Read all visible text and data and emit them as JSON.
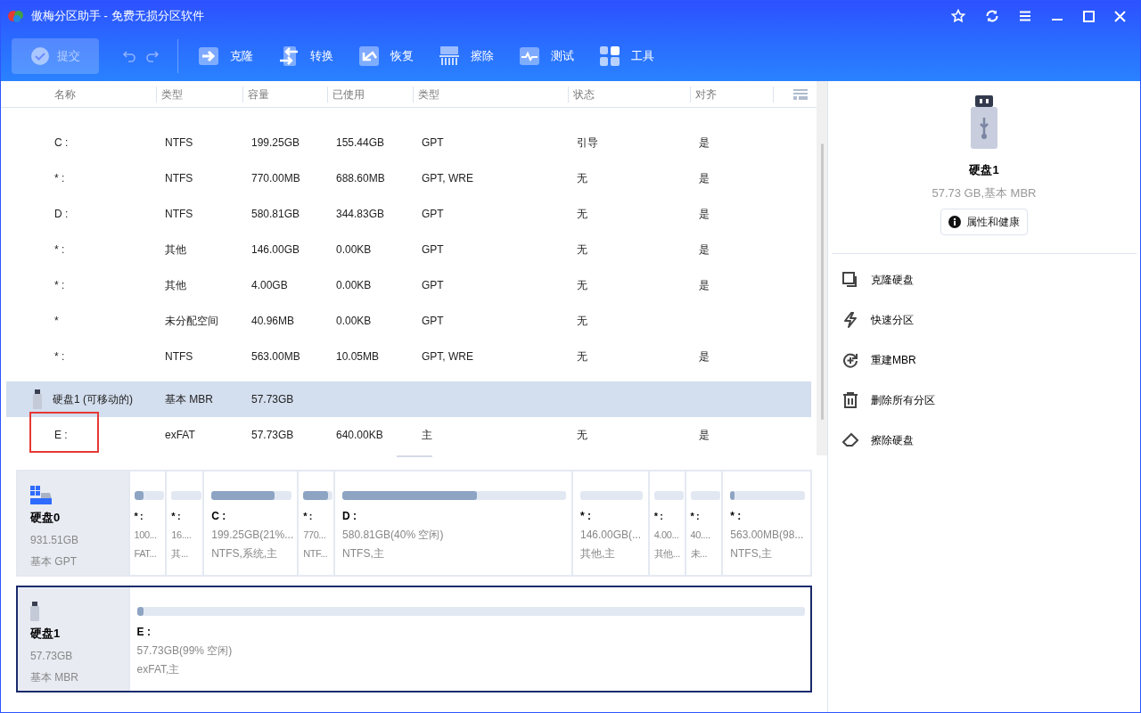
{
  "window": {
    "title": "傲梅分区助手 - 免费无损分区软件"
  },
  "toolbar": {
    "commit": {
      "label": "提交",
      "disabled": true
    },
    "tools": [
      {
        "kind": "clone",
        "label": "克隆"
      },
      {
        "kind": "convert",
        "label": "转换"
      },
      {
        "kind": "recover",
        "label": "恢复"
      },
      {
        "kind": "wipe",
        "label": "擦除"
      },
      {
        "kind": "test",
        "label": "测试"
      },
      {
        "kind": "tools",
        "label": "工具"
      }
    ]
  },
  "table": {
    "columns": [
      "名称",
      "类型",
      "容量",
      "已使用",
      "类型",
      "状态",
      "对齐"
    ],
    "rows": [
      {
        "kind": "partition",
        "selected": false,
        "highlighted": false,
        "cells": [
          "C :",
          "NTFS",
          "199.25GB",
          "155.44GB",
          "GPT",
          "引导",
          "是"
        ]
      },
      {
        "kind": "partition",
        "selected": false,
        "highlighted": false,
        "cells": [
          "* :",
          "NTFS",
          "770.00MB",
          "688.60MB",
          "GPT, WRE",
          "无",
          "是"
        ]
      },
      {
        "kind": "partition",
        "selected": false,
        "highlighted": false,
        "cells": [
          "D :",
          "NTFS",
          "580.81GB",
          "344.83GB",
          "GPT",
          "无",
          "是"
        ]
      },
      {
        "kind": "partition",
        "selected": false,
        "highlighted": false,
        "cells": [
          "* :",
          "其他",
          "146.00GB",
          "0.00KB",
          "GPT",
          "无",
          "是"
        ]
      },
      {
        "kind": "partition",
        "selected": false,
        "highlighted": false,
        "cells": [
          "* :",
          "其他",
          "4.00GB",
          "0.00KB",
          "GPT",
          "无",
          "是"
        ]
      },
      {
        "kind": "partition",
        "selected": false,
        "highlighted": false,
        "cells": [
          "*",
          "未分配空间",
          "40.96MB",
          "0.00KB",
          "GPT",
          "无",
          ""
        ]
      },
      {
        "kind": "partition",
        "selected": false,
        "highlighted": false,
        "cells": [
          "* :",
          "NTFS",
          "563.00MB",
          "10.05MB",
          "GPT, WRE",
          "无",
          "是"
        ]
      },
      {
        "kind": "disk",
        "selected": true,
        "highlighted": false,
        "cells": [
          "硬盘1 (可移动的)",
          "基本 MBR",
          "57.73GB",
          "",
          "",
          "",
          ""
        ]
      },
      {
        "kind": "partition",
        "selected": false,
        "highlighted": true,
        "cells": [
          "E :",
          "exFAT",
          "57.73GB",
          "640.00KB",
          "主",
          "无",
          "是"
        ]
      }
    ]
  },
  "disks": [
    {
      "kind": "ssd",
      "selected": false,
      "name": "硬盘0",
      "size": "931.51GB",
      "type": "基本 GPT",
      "partitions": [
        {
          "level": 0.3,
          "name": "* :",
          "info": "100...",
          "fs": "FAT..."
        },
        {
          "level": 0,
          "name": "* :",
          "info": "16....",
          "fs": "其..."
        },
        {
          "level": 0.79,
          "name": "C :",
          "info": "199.25GB(21%...",
          "fs": "NTFS,系统,主"
        },
        {
          "level": 0.85,
          "name": "* :",
          "info": "770...",
          "fs": "NTF..."
        },
        {
          "level": 0.6,
          "name": "D :",
          "info": "580.81GB(40% 空闲)",
          "fs": "NTFS,主"
        },
        {
          "level": 0,
          "name": "* :",
          "info": "146.00GB(...",
          "fs": "其他,主"
        },
        {
          "level": 0,
          "name": "* :",
          "info": "4.00...",
          "fs": "其他..."
        },
        {
          "level": 0,
          "name": "* :",
          "info": "40....",
          "fs": "未..."
        },
        {
          "level": 0.05,
          "name": "* :",
          "info": "563.00MB(98...",
          "fs": "NTFS,主"
        }
      ]
    },
    {
      "kind": "usb",
      "selected": true,
      "name": "硬盘1",
      "size": "57.73GB",
      "type": "基本 MBR",
      "partitions": [
        {
          "level": 0.01,
          "name": "E :",
          "info": "57.73GB(99% 空闲)",
          "fs": "exFAT,主"
        }
      ]
    }
  ],
  "side_panel": {
    "name": "硬盘1",
    "summary": "57.73 GB,基本 MBR",
    "properties_button": "属性和健康",
    "actions": [
      {
        "kind": "clone",
        "label": "克隆硬盘"
      },
      {
        "kind": "quick",
        "label": "快速分区"
      },
      {
        "kind": "rebuild",
        "label": "重建MBR"
      },
      {
        "kind": "delete",
        "label": "删除所有分区"
      },
      {
        "kind": "wipe",
        "label": "擦除硬盘"
      }
    ]
  }
}
